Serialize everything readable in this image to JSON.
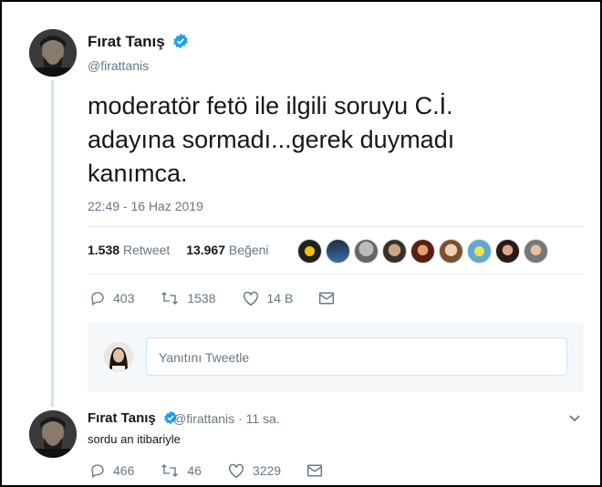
{
  "main_tweet": {
    "author_name": "Fırat Tanış",
    "handle": "@firattanis",
    "text_lines": [
      "moderatör fetö ile ilgili soruyu C.İ.",
      "adayına sormadı...gerek duymadı",
      "kanımca."
    ],
    "timestamp": "22:49 - 16 Haz 2019",
    "retweet_count": "1.538",
    "retweet_label": "Retweet",
    "like_count": "13.967",
    "like_label": "Beğeni",
    "actions": {
      "replies": "403",
      "retweets": "1538",
      "likes": "14 B"
    }
  },
  "reply_composer": {
    "placeholder": "Yanıtını Tweetle"
  },
  "reply_tweet": {
    "author_name": "Fırat Tanış",
    "handle": "@firattanis",
    "separator": "·",
    "time": "11 sa.",
    "text": "sordu an itibariyle",
    "actions": {
      "replies": "466",
      "retweets": "46",
      "likes": "3229"
    }
  },
  "colors": {
    "verified": "#1da1f2",
    "thread_line": "#c4e8f8",
    "muted": "#657786"
  },
  "icons": [
    "verified-badge-icon",
    "reply-icon",
    "retweet-icon",
    "like-icon",
    "dm-icon",
    "chevron-down-icon"
  ]
}
